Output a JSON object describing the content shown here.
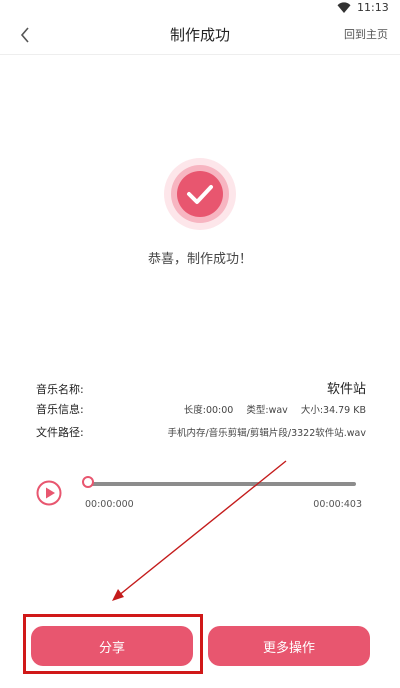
{
  "status_bar": {
    "time": "11:13",
    "icons": [
      "wifi-icon"
    ]
  },
  "header": {
    "title": "制作成功",
    "home_label": "回到主页",
    "back_icon": "chevron-left-icon"
  },
  "success": {
    "message": "恭喜，制作成功！",
    "icon": "check-circle-icon",
    "color": "#e8566f"
  },
  "info": {
    "name_label": "音乐名称:",
    "name_value": "软件站",
    "meta_label": "音乐信息:",
    "length": "长度:00:00",
    "type": "类型:wav",
    "size": "大小:34.79 KB",
    "path_label": "文件路径:",
    "path_value": "手机内存/音乐剪辑/剪辑片段/3322软件站.wav"
  },
  "player": {
    "play_icon": "play-icon",
    "current_time": "00:00:000",
    "total_time": "00:00:403",
    "progress": 0
  },
  "buttons": {
    "share": "分享",
    "more": "更多操作"
  },
  "colors": {
    "accent": "#e8566f",
    "annotation": "#d01818"
  }
}
